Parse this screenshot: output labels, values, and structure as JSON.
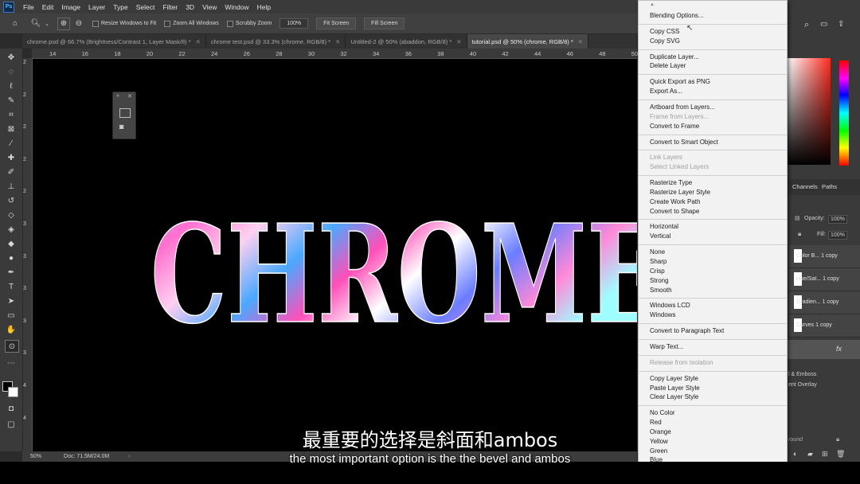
{
  "app": {
    "logo": "Ps"
  },
  "menubar": [
    "File",
    "Edit",
    "Image",
    "Layer",
    "Type",
    "Select",
    "Filter",
    "3D",
    "View",
    "Window",
    "Help"
  ],
  "options": {
    "resize_windows": "Resize Windows to Fit",
    "zoom_all": "Zoom All Windows",
    "scrubby": "Scrubby Zoom",
    "zoom_value": "100%",
    "fit_screen": "Fit Screen",
    "fill_screen": "Fill Screen"
  },
  "tabs": [
    {
      "label": "chrome.psd @ 66.7% (Brightness/Contrast 1, Layer Mask/8) *",
      "active": false
    },
    {
      "label": "chrome test.psd @ 33.3% (chrome, RGB/8) *",
      "active": false
    },
    {
      "label": "Untitled-2 @ 50% (abaddon, RGB/8) *",
      "active": false
    },
    {
      "label": "tutorial.psd @ 50% (chrome, RGB/8) *",
      "active": true
    }
  ],
  "ruler_h": [
    "14",
    "16",
    "18",
    "20",
    "22",
    "24",
    "26",
    "28",
    "30",
    "32",
    "34",
    "36",
    "38",
    "40",
    "42",
    "44",
    "46",
    "48",
    "50"
  ],
  "ruler_v": [
    "2",
    "2",
    "2",
    "2",
    "2",
    "3",
    "3",
    "3",
    "3",
    "3",
    "4",
    "4"
  ],
  "canvas": {
    "artwork_text": "CHROME"
  },
  "status": {
    "zoom": "50%",
    "doc": "Doc: 71.5M/24.0M"
  },
  "subtitles": {
    "zh": "最重要的选择是斜面和ambos",
    "en": "the most important option is the the bevel and ambos"
  },
  "context_menu": [
    {
      "label": "Blending Options...",
      "disabled": false
    },
    {
      "sep": true
    },
    {
      "label": "Copy CSS",
      "disabled": false
    },
    {
      "label": "Copy SVG",
      "disabled": false
    },
    {
      "sep": true
    },
    {
      "label": "Duplicate Layer...",
      "disabled": false
    },
    {
      "label": "Delete Layer",
      "disabled": false
    },
    {
      "sep": true
    },
    {
      "label": "Quick Export as PNG",
      "disabled": false
    },
    {
      "label": "Export As...",
      "disabled": false
    },
    {
      "sep": true
    },
    {
      "label": "Artboard from Layers...",
      "disabled": false
    },
    {
      "label": "Frame from Layers...",
      "disabled": true
    },
    {
      "label": "Convert to Frame",
      "disabled": false
    },
    {
      "sep": true
    },
    {
      "label": "Convert to Smart Object",
      "disabled": false
    },
    {
      "sep": true
    },
    {
      "label": "Link Layers",
      "disabled": true
    },
    {
      "label": "Select Linked Layers",
      "disabled": true
    },
    {
      "sep": true
    },
    {
      "label": "Rasterize Type",
      "disabled": false
    },
    {
      "label": "Rasterize Layer Style",
      "disabled": false
    },
    {
      "label": "Create Work Path",
      "disabled": false
    },
    {
      "label": "Convert to Shape",
      "disabled": false
    },
    {
      "sep": true
    },
    {
      "label": "Horizontal",
      "disabled": false
    },
    {
      "label": "Vertical",
      "disabled": false
    },
    {
      "sep": true
    },
    {
      "label": "None",
      "disabled": false
    },
    {
      "label": "Sharp",
      "disabled": false
    },
    {
      "label": "Crisp",
      "disabled": false
    },
    {
      "label": "Strong",
      "disabled": false
    },
    {
      "label": "Smooth",
      "disabled": false
    },
    {
      "sep": true
    },
    {
      "label": "Windows LCD",
      "disabled": false
    },
    {
      "label": "Windows",
      "disabled": false
    },
    {
      "sep": true
    },
    {
      "label": "Convert to Paragraph Text",
      "disabled": false
    },
    {
      "sep": true
    },
    {
      "label": "Warp Text...",
      "disabled": false
    },
    {
      "sep": true
    },
    {
      "label": "Release from Isolation",
      "disabled": true
    },
    {
      "sep": true
    },
    {
      "label": "Copy Layer Style",
      "disabled": false
    },
    {
      "label": "Paste Layer Style",
      "disabled": false
    },
    {
      "label": "Clear Layer Style",
      "disabled": false
    },
    {
      "sep": true
    },
    {
      "label": "No Color",
      "disabled": false
    },
    {
      "label": "Red",
      "disabled": false
    },
    {
      "label": "Orange",
      "disabled": false
    },
    {
      "label": "Yellow",
      "disabled": false
    },
    {
      "label": "Green",
      "disabled": false
    },
    {
      "label": "Blue",
      "disabled": false
    }
  ],
  "right_panel": {
    "panel_tabs": [
      "Channels",
      "Paths"
    ],
    "opacity_label": "Opacity:",
    "opacity_value": "100%",
    "fill_label": "Fill:",
    "fill_value": "100%",
    "layers": [
      "Color B... 1 copy",
      "Hue/Sat... 1 copy",
      "Gradien... 1 copy",
      "Curves 1 copy"
    ],
    "fx": "fx",
    "effects": [
      "l & Emboss",
      "ent Overlay"
    ],
    "bottom_label": "round"
  }
}
